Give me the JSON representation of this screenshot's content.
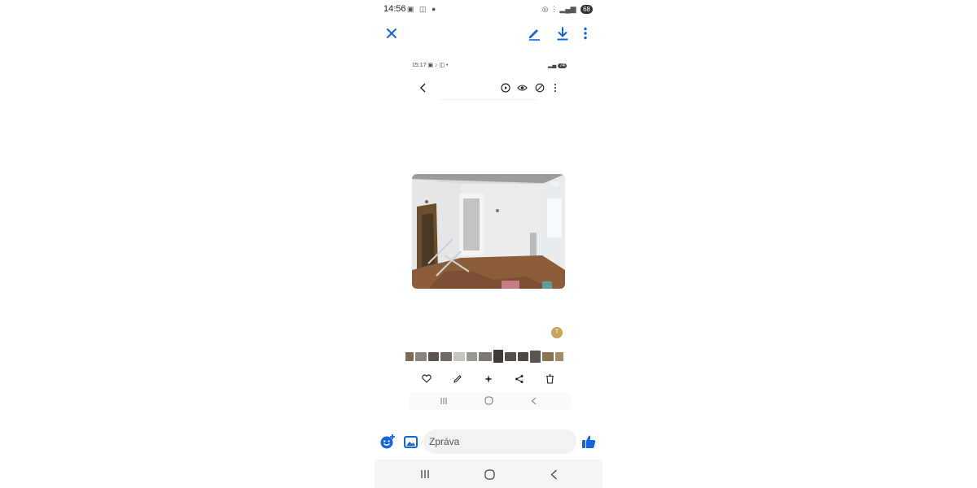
{
  "status_bar": {
    "time": "14:56",
    "battery": "68"
  },
  "inner_screenshot": {
    "status_time": "15:17",
    "status_battery": "74",
    "avatar_initial": "T"
  },
  "composer": {
    "placeholder": "Zpráva"
  },
  "colors": {
    "accent": "#1565d8",
    "nav_bg": "#f4f4f4",
    "input_bg": "#f2f2f4"
  },
  "icons": {
    "close": "close-icon",
    "edit": "pencil-icon",
    "download": "download-icon",
    "more": "more-vert-icon",
    "emoji": "emoji-add-icon",
    "gallery": "image-icon",
    "like": "thumbs-up-icon"
  }
}
